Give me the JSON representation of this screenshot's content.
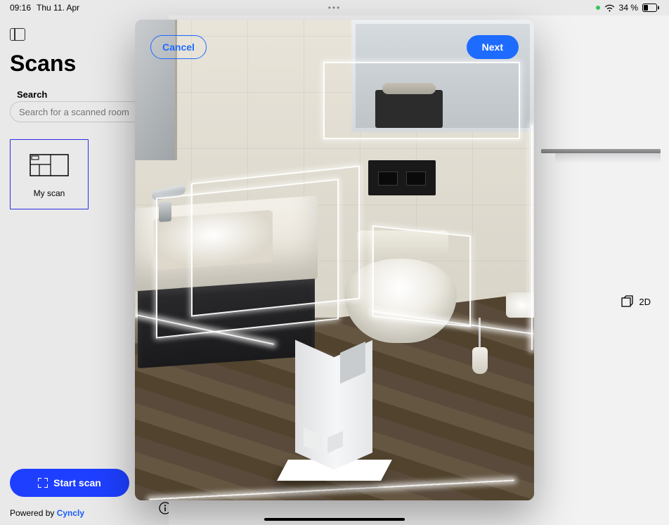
{
  "statusbar": {
    "time": "09:16",
    "date": "Thu 11. Apr",
    "battery": "34 %"
  },
  "sidebar": {
    "title": "Scans",
    "search_label": "Search",
    "search_placeholder": "Search for a scanned room",
    "scan_item": {
      "label": "My scan"
    },
    "start_scan_label": "Start scan",
    "powered_prefix": "Powered by ",
    "powered_brand": "Cyncly"
  },
  "right": {
    "view2d_label": "2D"
  },
  "modal": {
    "cancel_label": "Cancel",
    "next_label": "Next"
  }
}
